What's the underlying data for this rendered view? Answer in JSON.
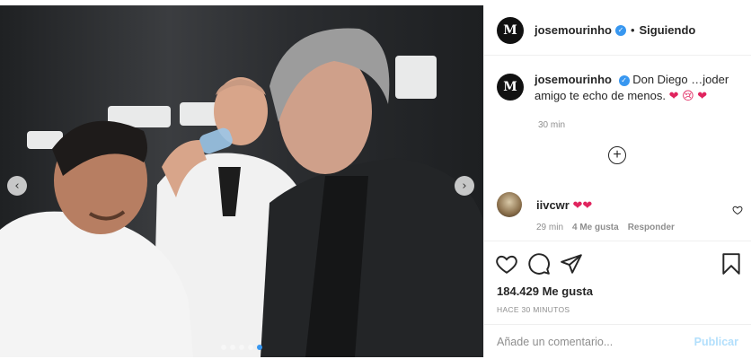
{
  "post": {
    "author": {
      "username": "josemourinho",
      "avatar_letter": "M",
      "follow_status": "Siguiendo",
      "separator": "•",
      "verified_mark": "✓"
    },
    "caption": {
      "username": "josemourinho",
      "text": "Don Diego …joder amigo te echo de menos.",
      "emojis": "❤ 😢 ❤",
      "time": "30 min"
    },
    "comments": [
      {
        "username": "iivcwr",
        "text": "❤❤",
        "time": "29 min",
        "likes": "4 Me gusta",
        "reply_label": "Responder"
      }
    ],
    "likes": "184.429 Me gusta",
    "posted_ago": "HACE 30 MINUTOS",
    "comment_input": {
      "placeholder": "Añade un comentario...",
      "publish_label": "Publicar"
    },
    "carousel": {
      "prev": "‹",
      "next": "›",
      "count": 5,
      "active_index": 4
    },
    "more_comments_symbol": "+"
  },
  "colors": {
    "accent": "#3897f0",
    "heart": "#e0245e",
    "publish_disabled": "#b2dffc",
    "muted": "#8e8e8e"
  },
  "icons": [
    "heart-icon",
    "comment-icon",
    "share-icon",
    "bookmark-icon",
    "verified-icon",
    "plus-circle-icon",
    "chevron-left-icon",
    "chevron-right-icon"
  ]
}
